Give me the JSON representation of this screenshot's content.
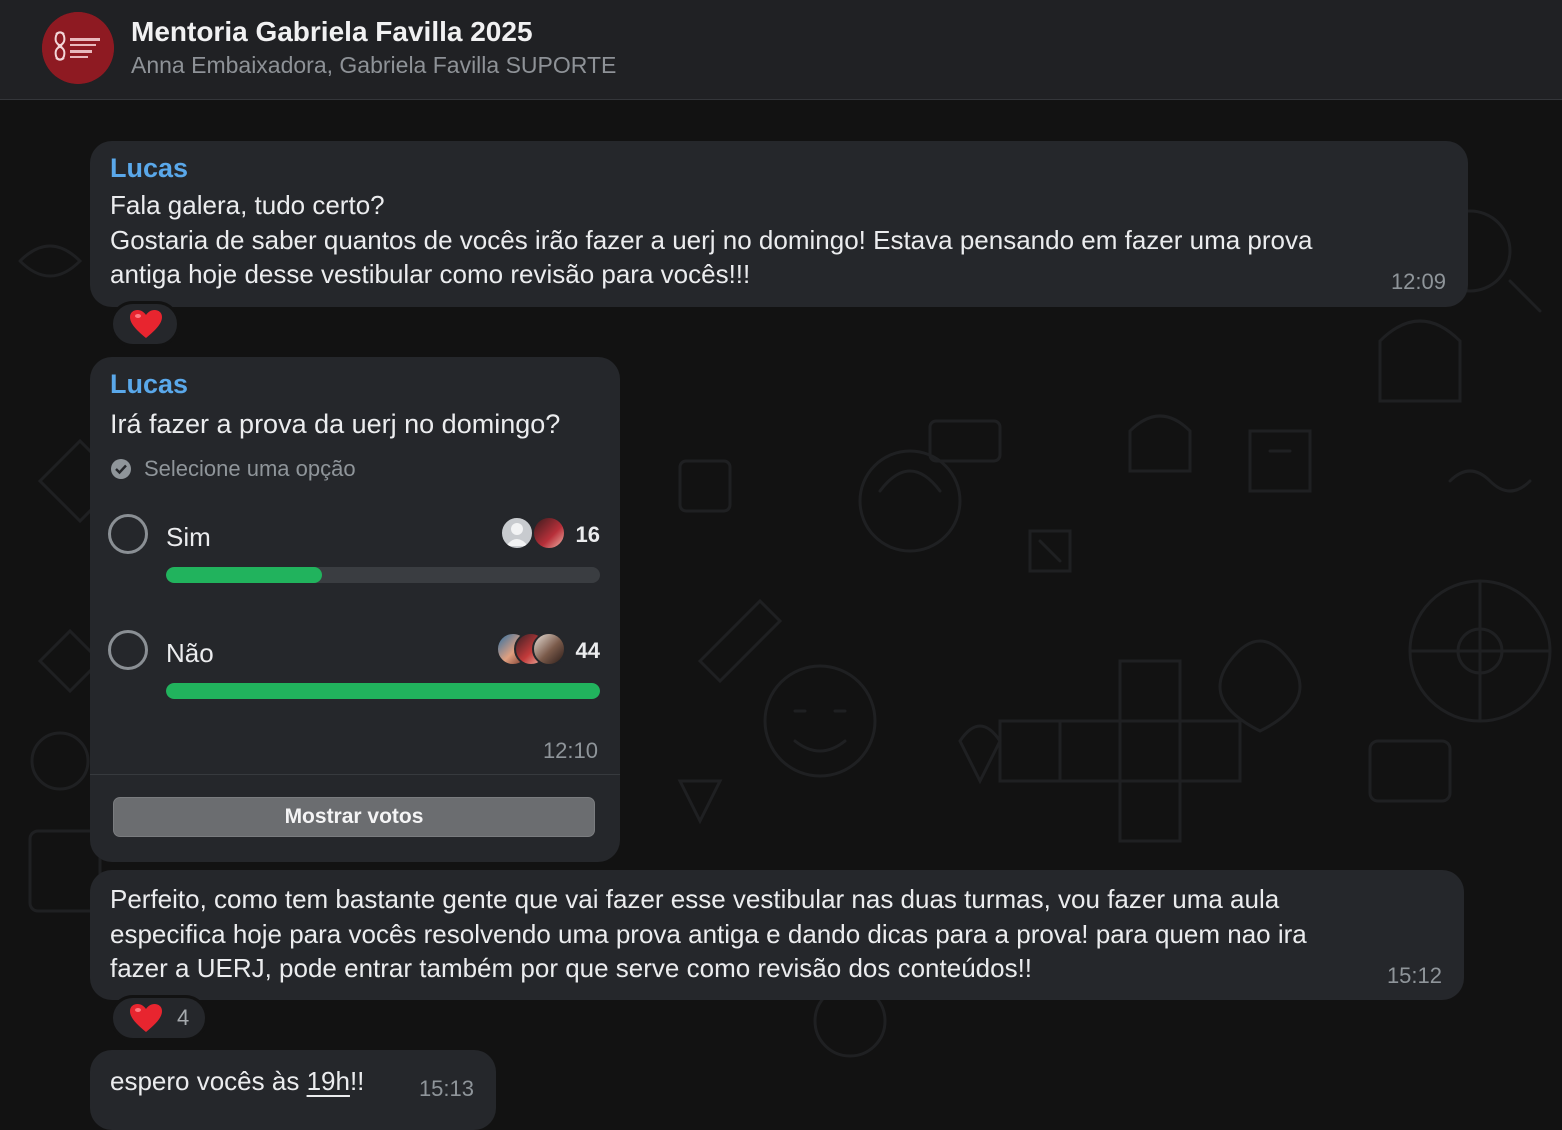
{
  "chat": {
    "title": "Mentoria Gabriela Favilla 2025",
    "subtitle": "Anna Embaixadora, Gabriela Favilla SUPORTE",
    "avatar_icon": "gabriela-favilla-logo",
    "avatar_color": "#8e1a22"
  },
  "messages": {
    "m1": {
      "sender": "Lucas",
      "line1": "Fala galera, tudo certo?",
      "line2": "Gostaria de saber quantos de vocês irão fazer a uerj no domingo! Estava pensando em fazer uma prova",
      "line3": "antiga hoje desse vestibular como revisão para vocês!!!",
      "time": "12:09",
      "reaction": {
        "emoji": "heart-icon"
      }
    },
    "poll": {
      "sender": "Lucas",
      "question": "Irá fazer a prova da uerj no domingo?",
      "hint": "Selecione uma opção",
      "options": [
        {
          "label": "Sim",
          "votes": "16",
          "fraction": 0.36
        },
        {
          "label": "Não",
          "votes": "44",
          "fraction": 1.0
        }
      ],
      "time": "12:10",
      "show_votes": "Mostrar votos"
    },
    "m3": {
      "line1": "Perfeito, como tem bastante gente que vai fazer esse vestibular nas duas turmas, vou fazer uma aula",
      "line2": "especifica hoje para vocês resolvendo uma prova antiga e dando dicas para a prova! para quem nao ira",
      "line3": "fazer a UERJ, pode entrar também por que serve como revisão dos conteúdos!!",
      "time": "15:12",
      "reaction": {
        "emoji": "heart-icon",
        "count": "4"
      }
    },
    "m4": {
      "text_before": "espero vocês às ",
      "text_link": "19h",
      "text_after": "!!",
      "time": "15:13"
    }
  },
  "colors": {
    "sender": "#5aa8ea",
    "poll_bar": "#21b35d",
    "bubble": "#25272b",
    "background": "#121212"
  }
}
